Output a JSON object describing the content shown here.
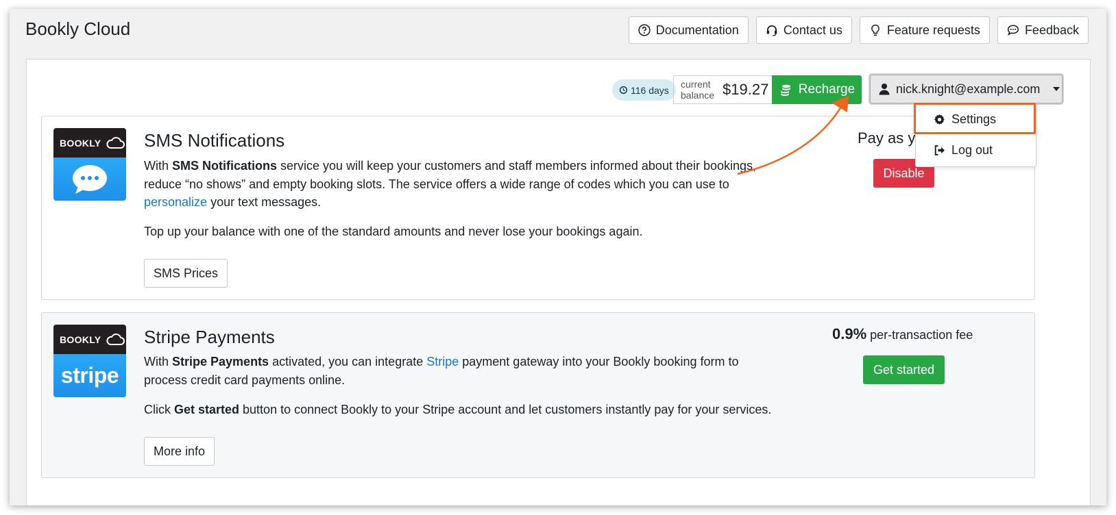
{
  "header": {
    "app_title": "Bookly Cloud",
    "buttons": [
      {
        "label": "Documentation",
        "icon": "question-circle-icon"
      },
      {
        "label": "Contact us",
        "icon": "headset-icon"
      },
      {
        "label": "Feature requests",
        "icon": "lightbulb-icon"
      },
      {
        "label": "Feedback",
        "icon": "chat-icon"
      }
    ]
  },
  "account_bar": {
    "days_badge": "116 days",
    "balance_label_line1": "current",
    "balance_label_line2": "balance",
    "balance_value": "$19.27",
    "recharge_label": "Recharge",
    "user_email": "nick.knight@example.com"
  },
  "user_menu": {
    "settings_label": "Settings",
    "logout_label": "Log out"
  },
  "sms_card": {
    "logo_text": "BOOKLY",
    "title": "SMS Notifications",
    "p1_prefix": "With ",
    "p1_bold": "SMS Notifications",
    "p1_middle": " service you will keep your customers and staff members informed about their bookings, reduce “no shows” and empty booking slots. The service offers a wide range of codes which you can use to ",
    "p1_link": "personalize",
    "p1_suffix": " your text messages.",
    "p2": "Top up your balance with one of the standard amounts and never lose your bookings again.",
    "button_label": "SMS Prices",
    "pay_title": "Pay as you go",
    "disable_label": "Disable"
  },
  "stripe_card": {
    "logo_text": "BOOKLY",
    "logo_word": "stripe",
    "title": "Stripe Payments",
    "p1_prefix": "With ",
    "p1_bold": "Stripe Payments",
    "p1_middle": " activated, you can integrate ",
    "p1_link": "Stripe",
    "p1_suffix": " payment gateway into your Bookly booking form to process credit card payments online.",
    "p2_prefix": "Click ",
    "p2_bold": "Get started",
    "p2_suffix": " button to connect Bookly to your Stripe account and let customers instantly pay for your services.",
    "button_label": "More info",
    "fee_value": "0.9%",
    "fee_label": " per-transaction fee",
    "get_started_label": "Get started"
  },
  "colors": {
    "success": "#28a745",
    "danger": "#dc3545",
    "link": "#1479c9",
    "highlight": "#f0641e"
  }
}
